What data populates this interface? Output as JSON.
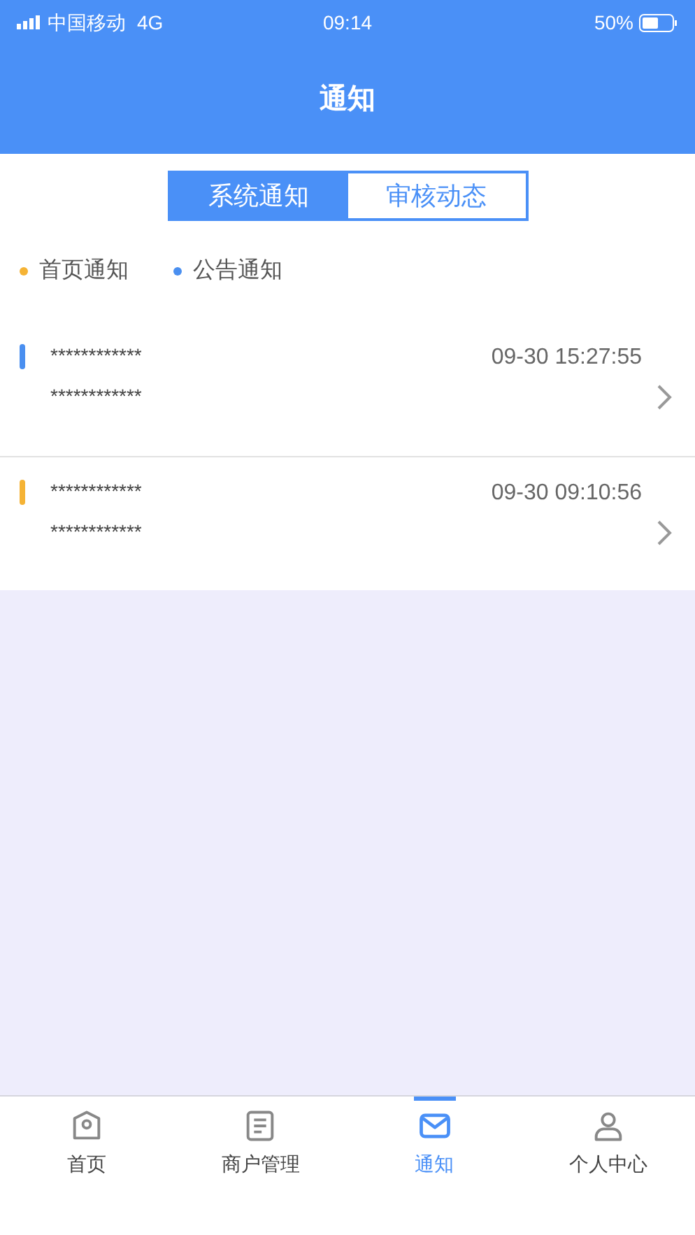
{
  "status_bar": {
    "carrier": "中国移动",
    "network": "4G",
    "time": "09:14",
    "battery": "50%"
  },
  "header": {
    "title": "通知"
  },
  "tabs": [
    {
      "label": "系统通知",
      "selected": true
    },
    {
      "label": "审核动态",
      "selected": false
    }
  ],
  "legend": [
    {
      "label": "首页通知",
      "color": "#f5b335"
    },
    {
      "label": "公告通知",
      "color": "#4a8ff0"
    }
  ],
  "notifications": [
    {
      "title": "************",
      "body": "************",
      "time": "09-30 15:27:55",
      "color": "#4a8ff0"
    },
    {
      "title": "************",
      "body": "************",
      "time": "09-30 09:10:56",
      "color": "#f5b335"
    }
  ],
  "tab_bar": [
    {
      "kind": "home",
      "label": "首页",
      "selected": false
    },
    {
      "kind": "document",
      "label": "商户管理",
      "selected": false
    },
    {
      "kind": "mail",
      "label": "通知",
      "selected": true
    },
    {
      "kind": "person",
      "label": "个人中心",
      "selected": false
    }
  ]
}
